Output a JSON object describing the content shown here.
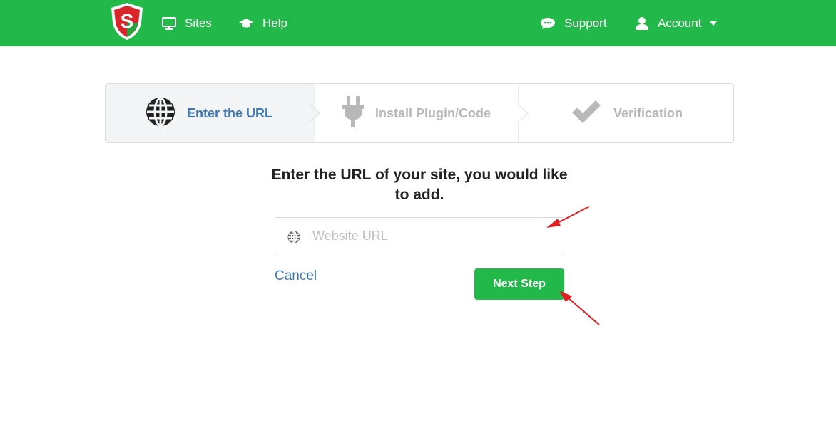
{
  "brand": {
    "logo_letter": "S",
    "icon": "shield-logo-icon",
    "color": "#22b84a"
  },
  "nav": {
    "left": [
      {
        "label": "Sites",
        "icon": "monitor-icon"
      },
      {
        "label": "Help",
        "icon": "graduation-cap-icon"
      }
    ],
    "right": [
      {
        "label": "Support",
        "icon": "chat-bubble-icon"
      },
      {
        "label": "Account",
        "icon": "user-icon",
        "dropdown": true
      }
    ]
  },
  "steps": [
    {
      "label": "Enter the URL",
      "icon": "globe-icon",
      "active": true
    },
    {
      "label": "Install Plugin/Code",
      "icon": "plug-icon",
      "active": false
    },
    {
      "label": "Verification",
      "icon": "checkmark-icon",
      "active": false
    }
  ],
  "form": {
    "heading": "Enter the URL of your site, you would like to add.",
    "url_placeholder": "Website URL",
    "url_value": "",
    "cancel_label": "Cancel",
    "next_label": "Next Step"
  },
  "colors": {
    "accent": "#22b84a",
    "link": "#3f78b5",
    "annotation_arrow": "#e02020"
  }
}
